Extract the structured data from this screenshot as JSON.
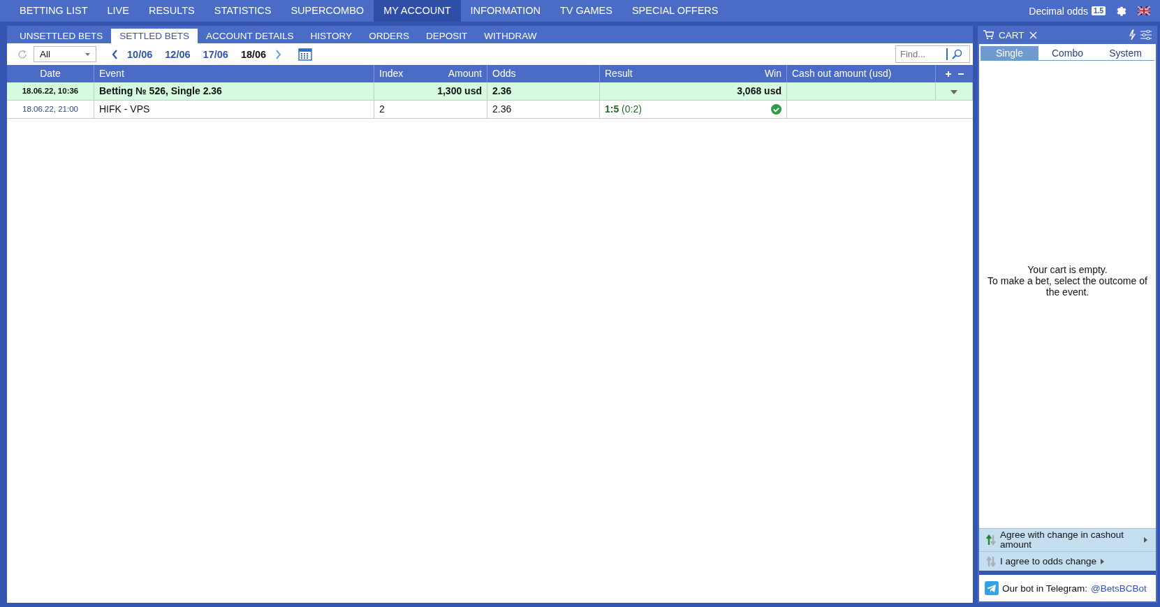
{
  "nav": [
    {
      "label": "BETTING LIST",
      "selected": false
    },
    {
      "label": "LIVE",
      "selected": false
    },
    {
      "label": "RESULTS",
      "selected": false
    },
    {
      "label": "STATISTICS",
      "selected": false
    },
    {
      "label": "SUPERCOMBO",
      "selected": false
    },
    {
      "label": "MY ACCOUNT",
      "selected": true
    },
    {
      "label": "INFORMATION",
      "selected": false
    },
    {
      "label": "TV GAMES",
      "selected": false
    },
    {
      "label": "SPECIAL OFFERS",
      "selected": false
    }
  ],
  "odds_format": {
    "label": "Decimal odds",
    "badge": "1.5"
  },
  "subtabs": [
    {
      "label": "UNSETTLED BETS",
      "selected": false
    },
    {
      "label": "SETTLED BETS",
      "selected": true
    },
    {
      "label": "ACCOUNT DETAILS",
      "selected": false
    },
    {
      "label": "HISTORY",
      "selected": false
    },
    {
      "label": "ORDERS",
      "selected": false
    },
    {
      "label": "DEPOSIT",
      "selected": false
    },
    {
      "label": "WITHDRAW",
      "selected": false
    }
  ],
  "filter": {
    "value": "All"
  },
  "dates": [
    {
      "label": "10/06",
      "selected": false
    },
    {
      "label": "12/06",
      "selected": false
    },
    {
      "label": "17/06",
      "selected": false
    },
    {
      "label": "18/06",
      "selected": true
    }
  ],
  "search": {
    "placeholder": "Find..."
  },
  "table": {
    "columns": [
      "Date",
      "Event",
      "Index",
      "Amount",
      "Odds",
      "Result",
      "Win",
      "Cash out amount (usd)"
    ],
    "rows": [
      {
        "kind": "bet",
        "date": "18.06.22,  10:36",
        "event": "Betting № 526, Single 2.36",
        "amount": "1,300 usd",
        "odds": "2.36",
        "win": "3,068 usd"
      },
      {
        "kind": "event",
        "date": "18.06.22, 21:00",
        "event": "HIFK - VPS",
        "index": "2",
        "odds": "2.36",
        "result": "**1:5** (0:2)",
        "won": true
      }
    ]
  },
  "cart": {
    "title": "CART",
    "tabs": [
      {
        "label": "Single",
        "selected": true
      },
      {
        "label": "Combo",
        "selected": false
      },
      {
        "label": "System",
        "selected": false
      }
    ],
    "empty_message": [
      "Your cart is empty.",
      "To make a bet, select the outcome of the event."
    ],
    "options": [
      {
        "label": "Agree with change in cashout amount",
        "on": true
      },
      {
        "label": "I agree to odds change",
        "on": false
      }
    ],
    "telegram": {
      "text": "Our bot in Telegram:",
      "link": "@BetsBCBot"
    }
  }
}
